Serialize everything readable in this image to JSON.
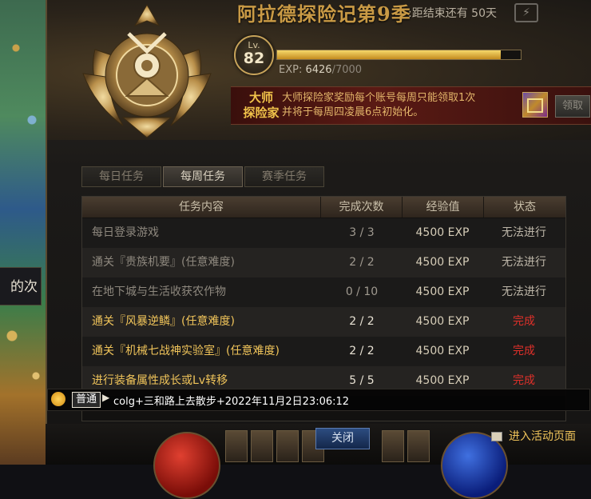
{
  "side_tip": "的次",
  "header": {
    "season_title": "阿拉德探险记第9季",
    "time_left": ":距结束还有 50天",
    "level_label": "Lv.",
    "level": "82",
    "exp_label": "EXP:",
    "exp_current": "6426",
    "exp_max": "/7000",
    "exp_fraction": 0.918
  },
  "master": {
    "title_line1": "大师",
    "title_line2": "探险家",
    "desc_line1": "大师探险家奖励每个账号每周只能领取1次",
    "desc_line2": "并将于每周四凌晨6点初始化。",
    "claim_label": "领取"
  },
  "tabs": [
    {
      "label": "每日任务",
      "active": false
    },
    {
      "label": "每周任务",
      "active": true
    },
    {
      "label": "赛季任务",
      "active": false
    }
  ],
  "table": {
    "headers": [
      "任务内容",
      "完成次数",
      "经验值",
      "状态"
    ],
    "rows": [
      {
        "name": "每日登录游戏",
        "count": "3 / 3",
        "exp": "4500 EXP",
        "status": "无法进行"
      },
      {
        "name": "通关『贵族机要』(任意难度)",
        "count": "2 / 2",
        "exp": "4500 EXP",
        "status": "无法进行"
      },
      {
        "name": "在地下城与生活收获农作物",
        "count": "0 / 10",
        "exp": "4500 EXP",
        "status": "无法进行"
      },
      {
        "name": "通关『风暴逆鳞』(任意难度)",
        "count": "2 / 2",
        "exp": "4500 EXP",
        "status": "完成"
      },
      {
        "name": "通关『机械七战神实验室』(任意难度)",
        "count": "2 / 2",
        "exp": "4500 EXP",
        "status": "完成"
      },
      {
        "name": "进行装备属性成长或Lv转移",
        "count": "5 / 5",
        "exp": "4500 EXP",
        "status": "完成"
      }
    ]
  },
  "chat": {
    "channel": "普通",
    "message": "colg+三和路上去散步+2022年11月2日23:06:12"
  },
  "footer": {
    "close_label": "关闭",
    "enter_label": "进入活动页面"
  }
}
